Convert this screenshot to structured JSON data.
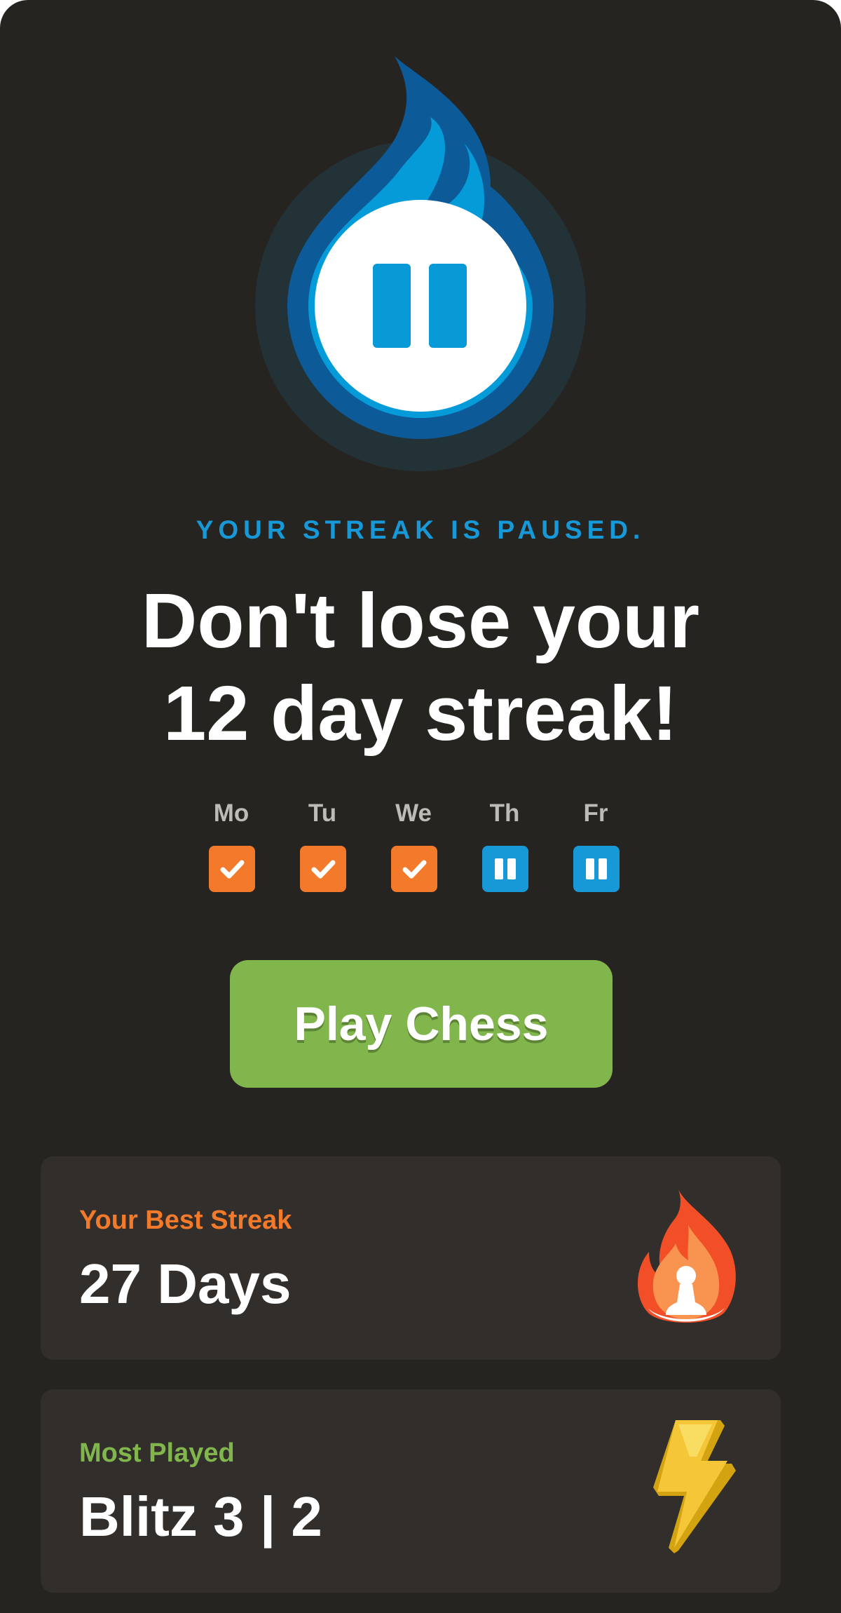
{
  "status": {
    "subtitle": "YOUR STREAK IS PAUSED.",
    "headline_line1": "Don't lose your",
    "headline_line2": "12 day streak!",
    "icon": "paused-flame-icon"
  },
  "week": [
    {
      "label": "Mo",
      "state": "completed",
      "icon": "checkmark-icon"
    },
    {
      "label": "Tu",
      "state": "completed",
      "icon": "checkmark-icon"
    },
    {
      "label": "We",
      "state": "completed",
      "icon": "checkmark-icon"
    },
    {
      "label": "Th",
      "state": "paused",
      "icon": "pause-icon"
    },
    {
      "label": "Fr",
      "state": "paused",
      "icon": "pause-icon"
    }
  ],
  "primary_action": {
    "label": "Play Chess"
  },
  "stats": [
    {
      "label": "Your Best Streak",
      "value": "27 Days",
      "label_color": "#f27a2a",
      "icon": "flame-pawn-icon"
    },
    {
      "label": "Most Played",
      "value": "Blitz 3 | 2",
      "label_color": "#81b64c",
      "icon": "lightning-bolt-icon"
    }
  ],
  "colors": {
    "background": "#262421",
    "card": "#312e2b",
    "accent_blue": "#1799d8",
    "accent_orange": "#f27a2a",
    "accent_green": "#81b64c"
  }
}
